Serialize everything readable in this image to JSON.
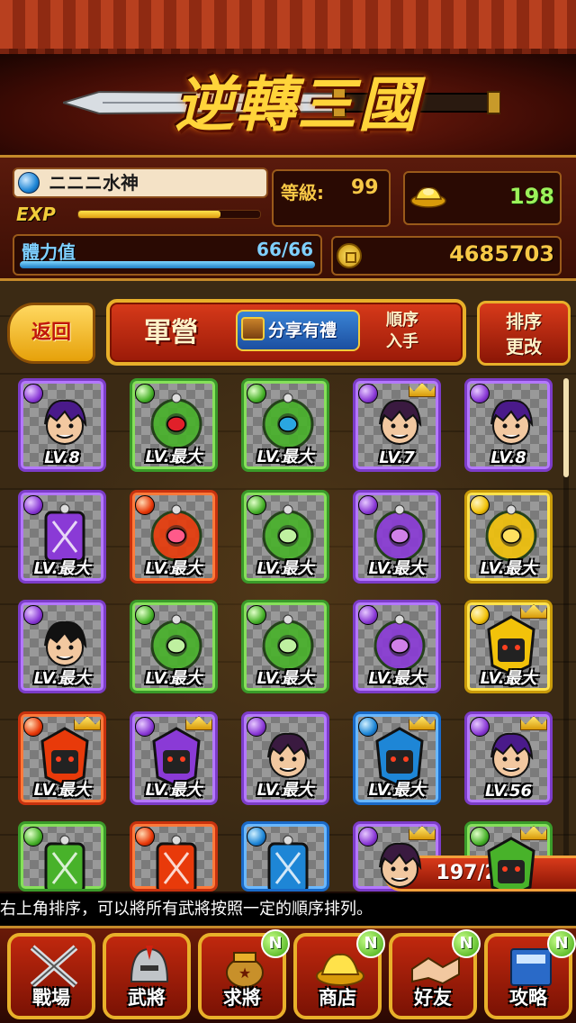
{
  "header": {
    "game_title": "逆轉三國"
  },
  "player": {
    "name": "ニニニ水神",
    "level_label": "等級:",
    "level": "99",
    "exp_label": "EXP",
    "exp_fraction": 0.78,
    "stamina_label": "體力值",
    "stamina": "66/66",
    "stamina_fraction": 1.0,
    "ingots": "198",
    "coins": "4685703"
  },
  "toolbar": {
    "back_label": "返回",
    "screen_title": "軍營",
    "share_label": "分享有禮",
    "sort_order_line1": "順序",
    "sort_order_line2": "入手",
    "sort_change_line1": "排序",
    "sort_change_line2": "更改"
  },
  "cards": [
    {
      "attribute": "purple",
      "level": "LV.8",
      "crowned": false,
      "art": "hero-purple-hair"
    },
    {
      "attribute": "green",
      "level": "LV.最大",
      "crowned": false,
      "art": "jade-ring-red"
    },
    {
      "attribute": "green",
      "level": "LV.最大",
      "crowned": false,
      "art": "jade-ring-blue"
    },
    {
      "attribute": "purple",
      "level": "LV.7",
      "crowned": true,
      "art": "dark-warrior"
    },
    {
      "attribute": "purple",
      "level": "LV.8",
      "crowned": false,
      "art": "hero-purple-hair"
    },
    {
      "attribute": "purple",
      "level": "LV.最大",
      "crowned": false,
      "art": "talisman-purple"
    },
    {
      "attribute": "red",
      "level": "LV.最大",
      "crowned": false,
      "art": "jade-ring-pink"
    },
    {
      "attribute": "green",
      "level": "LV.最大",
      "crowned": false,
      "art": "jade-ring-green"
    },
    {
      "attribute": "purple",
      "level": "LV.最大",
      "crowned": false,
      "art": "jade-ring-violet"
    },
    {
      "attribute": "gold",
      "level": "LV.最大",
      "crowned": false,
      "art": "jade-ring-gold"
    },
    {
      "attribute": "purple",
      "level": "LV.最大",
      "crowned": false,
      "art": "hero-young"
    },
    {
      "attribute": "green",
      "level": "LV.最大",
      "crowned": false,
      "art": "jade-ring-green"
    },
    {
      "attribute": "green",
      "level": "LV.最大",
      "crowned": false,
      "art": "jade-ring-green"
    },
    {
      "attribute": "purple",
      "level": "LV.最大",
      "crowned": false,
      "art": "jade-ring-violet"
    },
    {
      "attribute": "gold",
      "level": "LV.最大",
      "crowned": true,
      "art": "armor-gold"
    },
    {
      "attribute": "red",
      "level": "LV.最大",
      "crowned": true,
      "art": "armor-red"
    },
    {
      "attribute": "purple",
      "level": "LV.最大",
      "crowned": true,
      "art": "armor-purple"
    },
    {
      "attribute": "purple",
      "level": "LV.最大",
      "crowned": false,
      "art": "dark-warrior"
    },
    {
      "attribute": "blue",
      "level": "LV.最大",
      "crowned": true,
      "art": "armor-blue"
    },
    {
      "attribute": "purple",
      "level": "LV.56",
      "crowned": true,
      "art": "sorceress-purple"
    },
    {
      "attribute": "green",
      "level": "",
      "crowned": false,
      "art": "talisman-green"
    },
    {
      "attribute": "red",
      "level": "",
      "crowned": false,
      "art": "talisman-red"
    },
    {
      "attribute": "blue",
      "level": "",
      "crowned": false,
      "art": "talisman-blue"
    },
    {
      "attribute": "purple",
      "level": "",
      "crowned": true,
      "art": "dark-warrior"
    },
    {
      "attribute": "green",
      "level": "",
      "crowned": true,
      "art": "armor-green"
    }
  ],
  "inventory": {
    "count": "197/200"
  },
  "ticker": {
    "text": "右上角排序，可以將所有武將按照一定的順序排列。"
  },
  "nav": [
    {
      "label": "戰場",
      "icon": "crossed-swords-icon",
      "new": false
    },
    {
      "label": "武將",
      "icon": "helmet-icon",
      "new": false
    },
    {
      "label": "求將",
      "icon": "summon-pot-icon",
      "new": true
    },
    {
      "label": "商店",
      "icon": "gold-ingot-icon",
      "new": true
    },
    {
      "label": "好友",
      "icon": "handshake-icon",
      "new": true
    },
    {
      "label": "攻略",
      "icon": "guide-book-icon",
      "new": true
    }
  ],
  "new_badge_label": "N",
  "colors": {
    "purple": "#8a3ad6",
    "green": "#48b22a",
    "red": "#e83a0a",
    "gold": "#f2c20a",
    "blue": "#1e86d6"
  }
}
